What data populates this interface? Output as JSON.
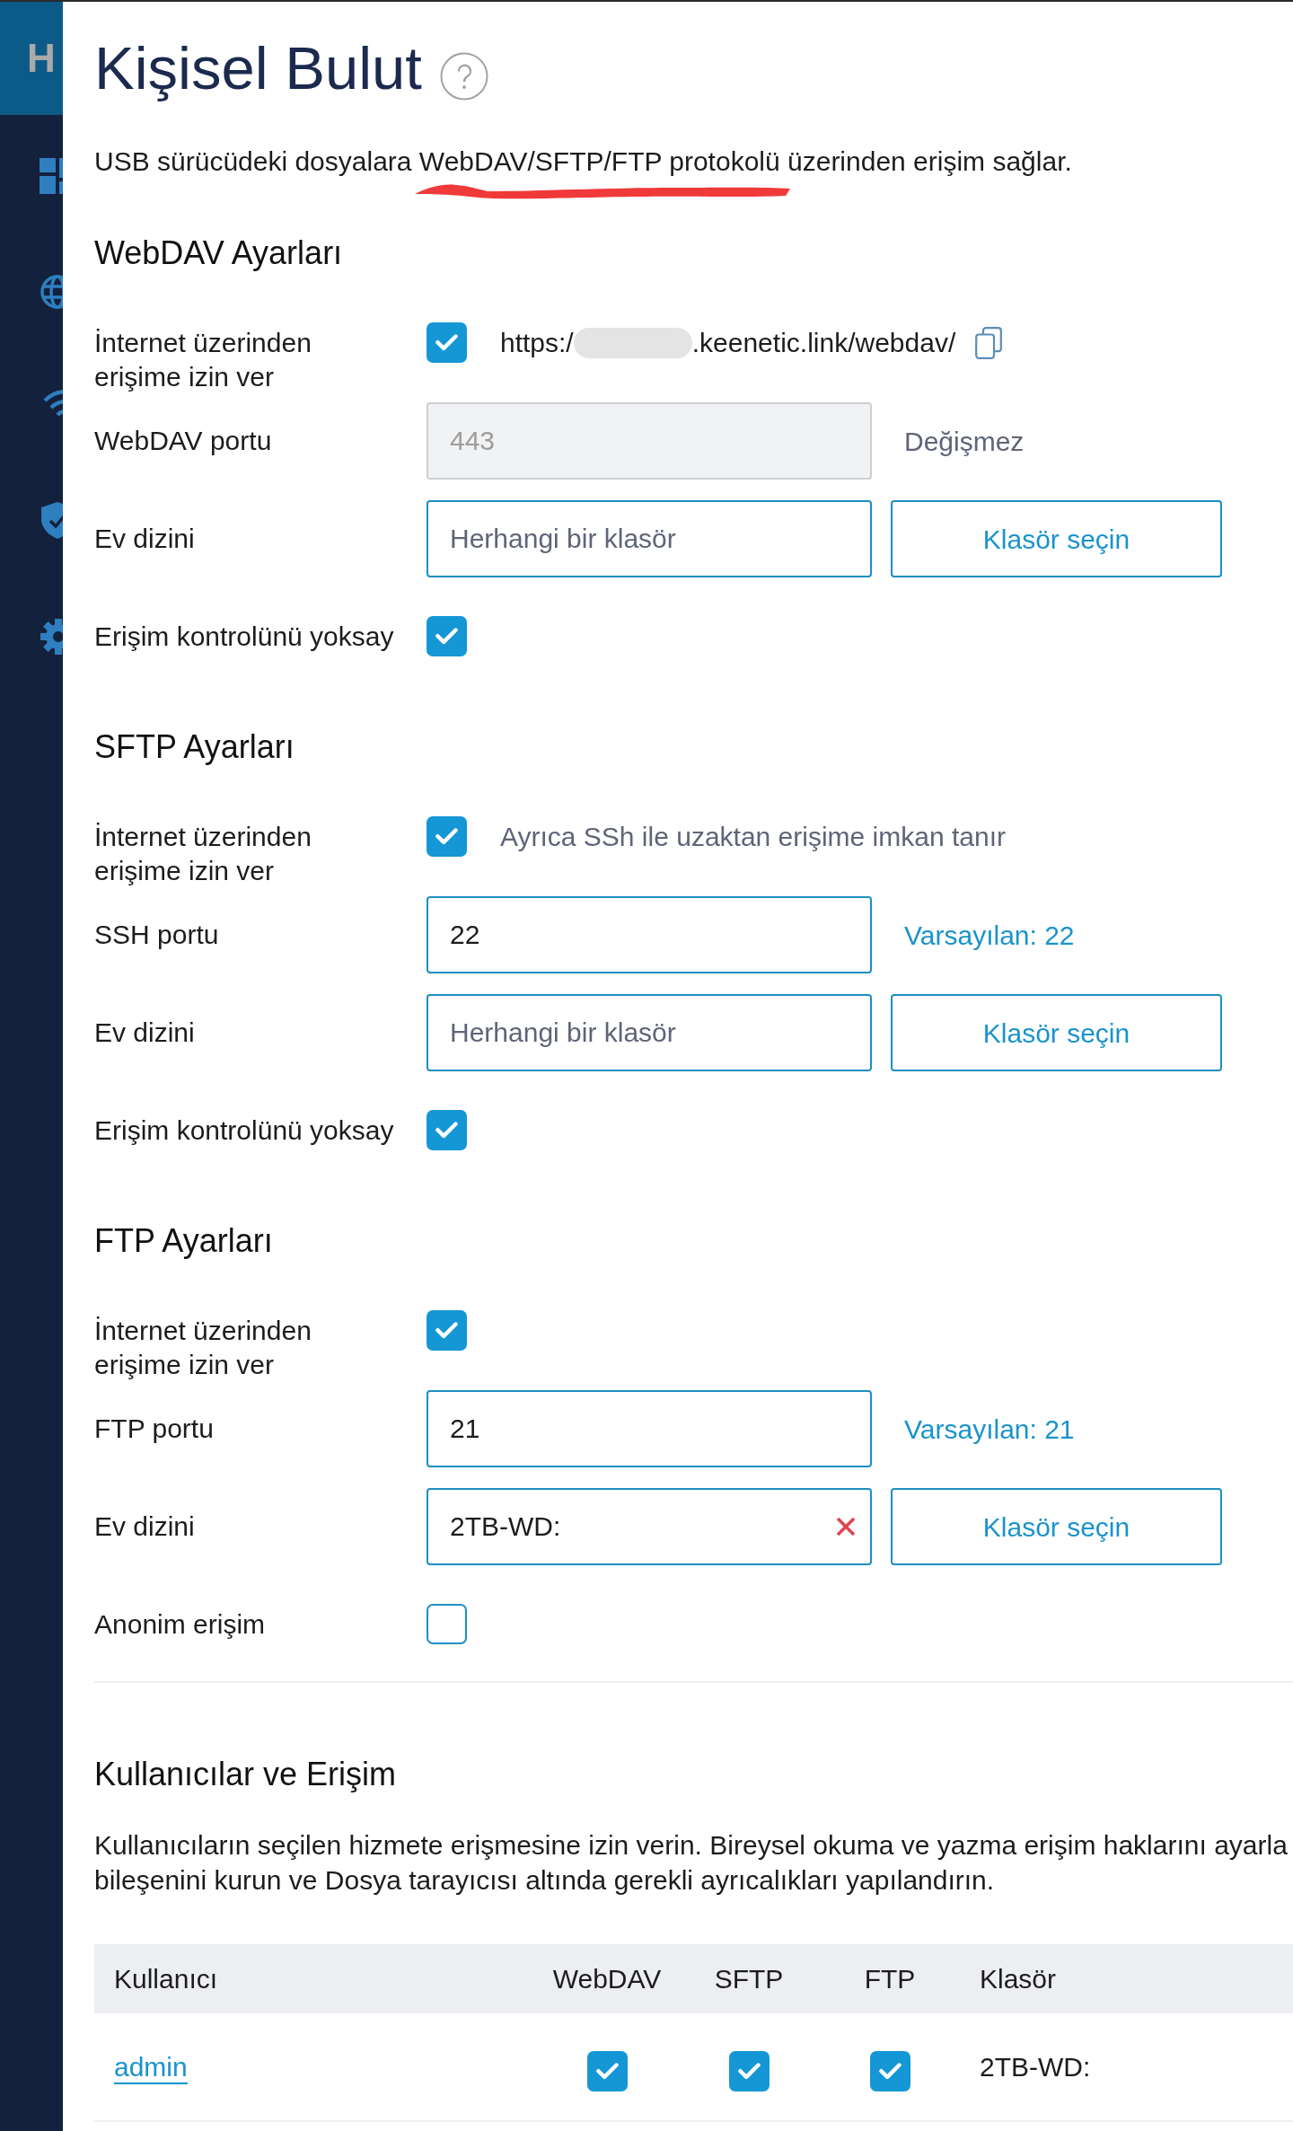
{
  "sidebar": {
    "logo": "H"
  },
  "page": {
    "title": "Kişisel Bulut",
    "description": [
      {
        "text": "USB sürücüdeki dosyalara "
      },
      {
        "text": "WebDAV/SFTP/FTP protokolü",
        "scribbled": true
      },
      {
        "text": " üzerinden erişim sağlar."
      }
    ]
  },
  "sections": [
    {
      "title": "WebDAV Ayarları",
      "rows": [
        {
          "kind": "checkbox",
          "label": "İnternet üzerinden erişime izin ver",
          "checked": true,
          "url": [
            {
              "kind": "text",
              "text": "https:/"
            },
            {
              "kind": "redacted"
            },
            {
              "kind": "text",
              "text": ".keenetic.link/webdav/"
            }
          ]
        },
        {
          "kind": "input",
          "label": "WebDAV portu",
          "value": "443",
          "disabled": true,
          "hint": {
            "kind": "fixed",
            "text": "Değişmez"
          }
        },
        {
          "kind": "folder",
          "label": "Ev dizini",
          "placeholder": "Herhangi bir klasör",
          "button": "Klasör seçin"
        },
        {
          "kind": "checkbox",
          "label": "Erişim kontrolünü yoksay",
          "checked": true
        }
      ]
    },
    {
      "title": "SFTP Ayarları",
      "rows": [
        {
          "kind": "checkbox",
          "label": "İnternet üzerinden erişime izin ver",
          "checked": true,
          "note": "Ayrıca SSh ile uzaktan erişime imkan tanır"
        },
        {
          "kind": "input",
          "label": "SSH portu",
          "value": "22",
          "disabled": false,
          "hint": {
            "kind": "default",
            "text": "Varsayılan: 22"
          }
        },
        {
          "kind": "folder",
          "label": "Ev dizini",
          "placeholder": "Herhangi bir klasör",
          "button": "Klasör seçin"
        },
        {
          "kind": "checkbox",
          "label": "Erişim kontrolünü yoksay",
          "checked": true
        }
      ]
    },
    {
      "title": "FTP Ayarları",
      "rows": [
        {
          "kind": "checkbox",
          "label": "İnternet üzerinden erişime izin ver",
          "checked": true
        },
        {
          "kind": "input",
          "label": "FTP portu",
          "value": "21",
          "disabled": false,
          "hint": {
            "kind": "default",
            "text": "Varsayılan: 21"
          }
        },
        {
          "kind": "folder",
          "label": "Ev dizini",
          "value": "2TB-WD:",
          "button": "Klasör seçin"
        },
        {
          "kind": "checkbox",
          "label": "Anonim erişim",
          "checked": false
        }
      ]
    }
  ],
  "users": {
    "title": "Kullanıcılar ve Erişim",
    "description": [
      "Kullanıcıların seçilen hizmete erişmesine izin verin. Bireysel okuma ve yazma erişim haklarını ayarla",
      "bileşenini kurun ve Dosya tarayıcısı altında gerekli ayrıcalıkları yapılandırın."
    ],
    "table": {
      "columns": [
        "Kullanıcı",
        "WebDAV",
        "SFTP",
        "FTP",
        "Klasör"
      ],
      "rows": [
        {
          "cells": [
            {
              "kind": "link",
              "text": "admin"
            },
            {
              "kind": "checkbox",
              "checked": true
            },
            {
              "kind": "checkbox",
              "checked": true
            },
            {
              "kind": "checkbox",
              "checked": true
            },
            {
              "kind": "text",
              "text": "2TB-WD:"
            }
          ]
        }
      ]
    }
  }
}
